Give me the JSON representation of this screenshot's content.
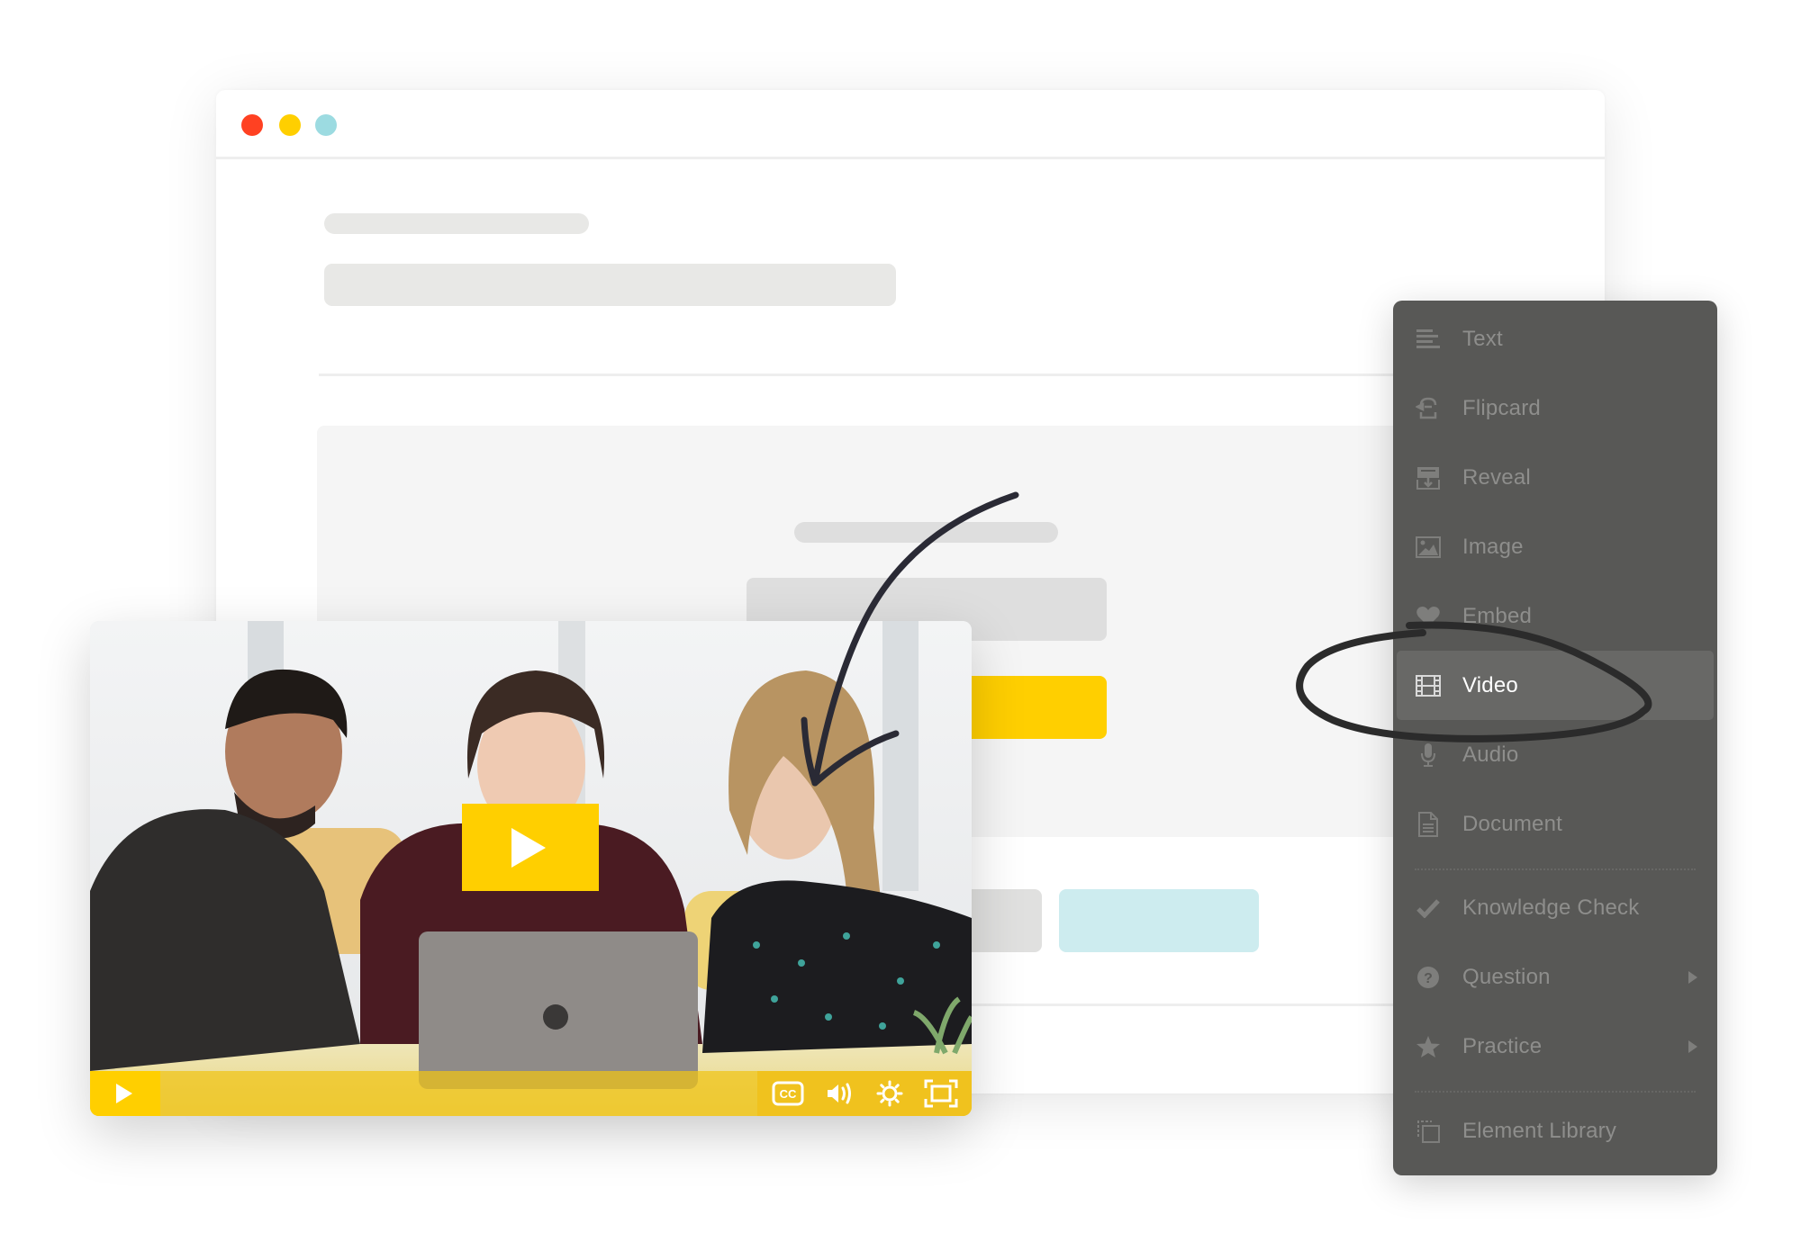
{
  "window": {
    "controls": [
      {
        "name": "close",
        "color": "#ff4122"
      },
      {
        "name": "minimize",
        "color": "#ffcf00"
      },
      {
        "name": "maximize",
        "color": "#9cdbe1"
      }
    ]
  },
  "colors": {
    "accent_yellow": "#ffcf00",
    "accent_cyan": "#cdecef",
    "skeleton_gray": "#e8e8e6",
    "menu_bg": "#585856",
    "menu_active_bg": "#686866",
    "menu_text": "#8e8e8c",
    "menu_active_text": "#ffffff",
    "annotation_ink": "#2a2a35"
  },
  "video_player": {
    "big_play_icon": "play-icon",
    "controls": [
      {
        "name": "play",
        "icon": "play-icon"
      },
      {
        "name": "captions",
        "icon": "cc-icon",
        "label": "CC"
      },
      {
        "name": "volume",
        "icon": "volume-icon"
      },
      {
        "name": "settings",
        "icon": "gear-icon"
      },
      {
        "name": "fullscreen",
        "icon": "fullscreen-icon"
      }
    ]
  },
  "menu": {
    "items": [
      {
        "label": "Text",
        "icon": "text-lines-icon",
        "active": false,
        "submenu": false
      },
      {
        "label": "Flipcard",
        "icon": "flipcard-icon",
        "active": false,
        "submenu": false
      },
      {
        "label": "Reveal",
        "icon": "reveal-icon",
        "active": false,
        "submenu": false
      },
      {
        "label": "Image",
        "icon": "image-icon",
        "active": false,
        "submenu": false
      },
      {
        "label": "Embed",
        "icon": "heart-icon",
        "active": false,
        "submenu": false
      },
      {
        "label": "Video",
        "icon": "film-icon",
        "active": true,
        "submenu": false
      },
      {
        "label": "Audio",
        "icon": "microphone-icon",
        "active": false,
        "submenu": false
      },
      {
        "label": "Document",
        "icon": "document-icon",
        "active": false,
        "submenu": false
      },
      {
        "label": "Knowledge Check",
        "icon": "checkmark-icon",
        "active": false,
        "submenu": false
      },
      {
        "label": "Question",
        "icon": "question-circle-icon",
        "active": false,
        "submenu": true
      },
      {
        "label": "Practice",
        "icon": "star-icon",
        "active": false,
        "submenu": true
      },
      {
        "label": "Element Library",
        "icon": "copy-stack-icon",
        "active": false,
        "submenu": false
      }
    ]
  }
}
